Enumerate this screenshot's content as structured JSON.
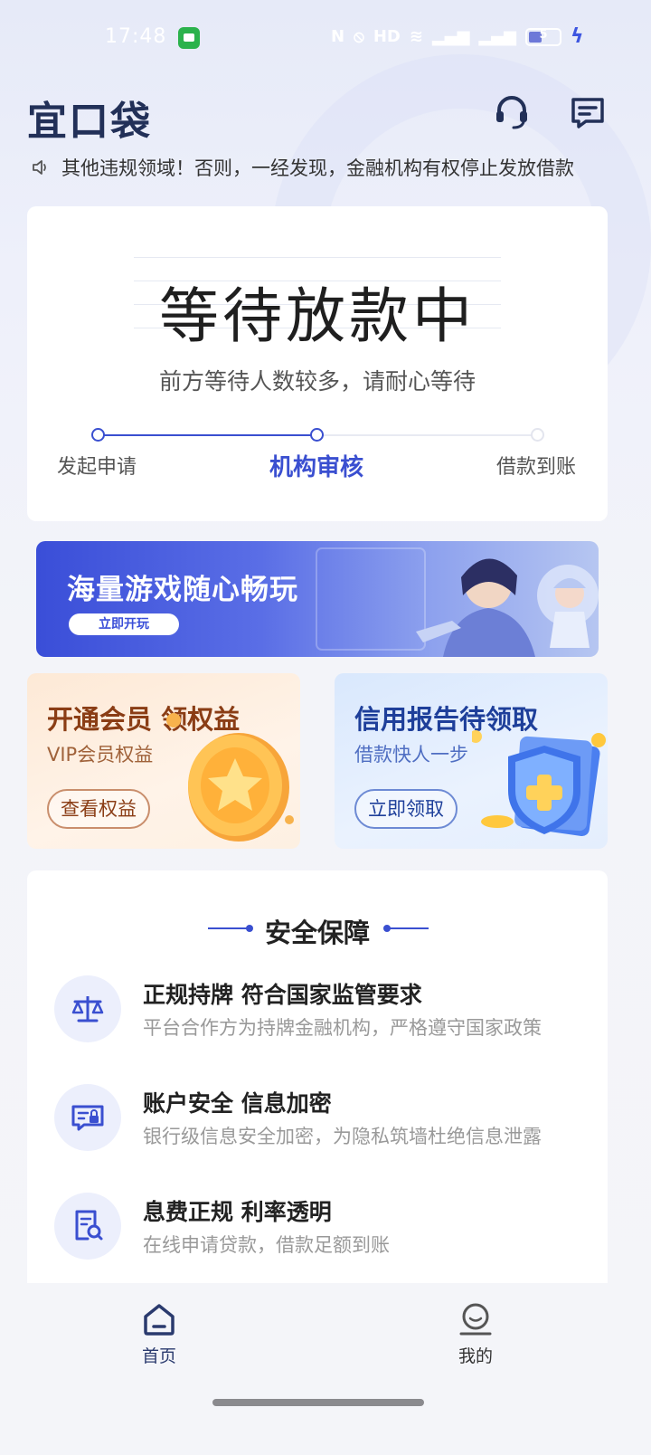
{
  "status_bar": {
    "time": "17:48",
    "battery": "5"
  },
  "header": {
    "logo_text": "宜口袋"
  },
  "notice": {
    "text": "其他违规领域！否则，一经发现，金融机构有权停止发放借款"
  },
  "loan_status": {
    "title": "等待放款中",
    "subtitle": "前方等待人数较多，请耐心等待",
    "progress_fraction": 0.5,
    "steps": [
      {
        "label": "发起申请",
        "state": "done"
      },
      {
        "label": "机构审核",
        "state": "active"
      },
      {
        "label": "借款到账",
        "state": "pending"
      }
    ]
  },
  "game_banner": {
    "title": "海量游戏随心畅玩",
    "button": "立即开玩"
  },
  "promos": {
    "vip": {
      "title": "开通会员 领权益",
      "subtitle": "VIP会员权益",
      "button": "查看权益"
    },
    "credit": {
      "title": "信用报告待领取",
      "subtitle": "借款快人一步",
      "button": "立即领取"
    }
  },
  "security": {
    "heading": "安全保障",
    "items": [
      {
        "icon": "scale-icon",
        "title": "正规持牌 符合国家监管要求",
        "desc": "平台合作方为持牌金融机构，严格遵守国家政策"
      },
      {
        "icon": "id-lock-icon",
        "title": "账户安全 信息加密",
        "desc": "银行级信息安全加密，为隐私筑墙杜绝信息泄露"
      },
      {
        "icon": "doc-search-icon",
        "title": "息费正规  利率透明",
        "desc": "在线申请贷款，借款足额到账"
      }
    ]
  },
  "tabbar": {
    "items": [
      {
        "label": "首页",
        "icon": "home-icon",
        "active": true
      },
      {
        "label": "我的",
        "icon": "profile-icon",
        "active": false
      }
    ]
  },
  "colors": {
    "accent": "#3a4fd0",
    "logo": "#223058",
    "card": "#ffffff"
  }
}
